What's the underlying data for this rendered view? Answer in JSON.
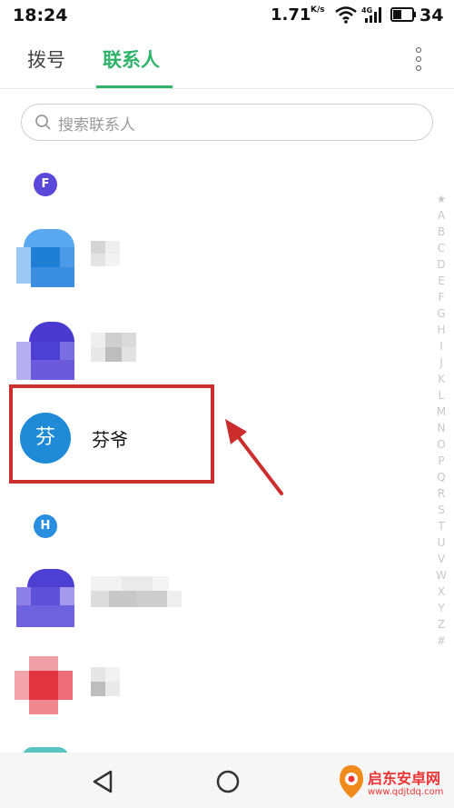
{
  "status_bar": {
    "time": "18:24",
    "net_speed": "1.71",
    "net_unit": "K/s",
    "battery": "34",
    "wifi_icon": "wifi-icon",
    "signal_icon": "signal-4g-icon",
    "battery_icon": "battery-icon"
  },
  "tabs": [
    {
      "label": "拨号",
      "active": false
    },
    {
      "label": "联系人",
      "active": true
    }
  ],
  "more_icon": "more-vertical-icon",
  "search": {
    "placeholder": "搜索联系人",
    "icon": "search-icon"
  },
  "sections": [
    {
      "letter": "F",
      "color": "#5a48d8"
    },
    {
      "letter": "H",
      "color": "#2a8ee0"
    }
  ],
  "highlighted_contact": {
    "avatar_text": "芬",
    "name": "芬爷",
    "avatar_color": "#1f8ad6"
  },
  "annotation": {
    "box_color": "#cc2d2d"
  },
  "alpha_index": [
    "★",
    "A",
    "B",
    "C",
    "D",
    "E",
    "F",
    "G",
    "H",
    "I",
    "J",
    "K",
    "L",
    "M",
    "N",
    "O",
    "P",
    "Q",
    "R",
    "S",
    "T",
    "U",
    "V",
    "W",
    "X",
    "Y",
    "Z",
    "#"
  ],
  "nav": {
    "back_icon": "back-triangle-icon",
    "home_icon": "home-circle-icon"
  },
  "watermark": {
    "title": "启东安卓网",
    "url": "www.qdjtdq.com"
  }
}
